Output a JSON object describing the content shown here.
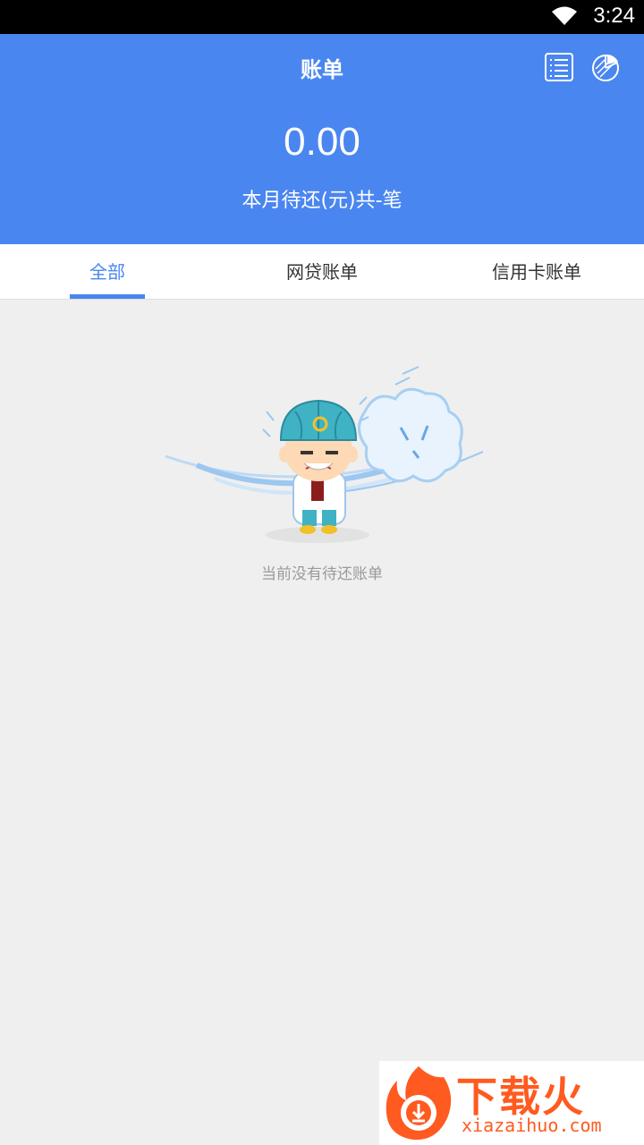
{
  "status_bar": {
    "time": "3:24"
  },
  "header": {
    "title": "账单",
    "amount": "0.00",
    "subtitle": "本月待还(元)共-笔",
    "icons": [
      "list-icon",
      "pie-chart-icon"
    ]
  },
  "tabs": [
    {
      "label": "全部",
      "active": true
    },
    {
      "label": "网贷账单",
      "active": false
    },
    {
      "label": "信用卡账单",
      "active": false
    }
  ],
  "empty_state": {
    "message": "当前没有待还账单"
  },
  "watermark": {
    "name": "下载火",
    "domain": "xiazaihuo.com"
  },
  "colors": {
    "primary": "#4a86f0",
    "background": "#efefef",
    "watermark": "#ff5a1f"
  }
}
